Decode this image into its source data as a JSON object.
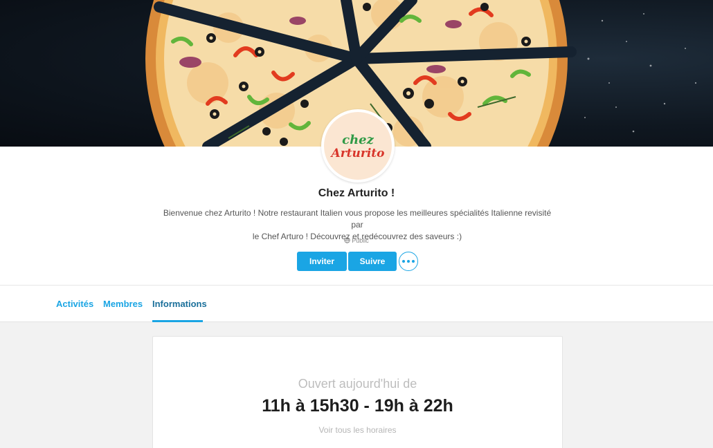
{
  "group": {
    "name": "Chez Arturito !",
    "description_line1": "Bienvenue chez Arturito ! Notre restaurant Italien vous propose les meilleures spécialités Italienne revisité par",
    "description_line2": "le Chef Arturo ! Découvrez et redécouvrez des saveurs :)",
    "visibility": "Public",
    "logo": {
      "line1": "chez",
      "line2": "Arturito"
    }
  },
  "actions": {
    "invite_label": "Inviter",
    "follow_label": "Suivre",
    "more_icon": "more-dots-icon"
  },
  "tabs": [
    {
      "label": "Activités",
      "active": false
    },
    {
      "label": "Membres",
      "active": false
    },
    {
      "label": "Informations",
      "active": true
    }
  ],
  "info_card": {
    "open_label": "Ouvert aujourd'hui de",
    "hours": "11h à 15h30 - 19h à 22h",
    "all_hours_link": "Voir tous les horaires"
  },
  "colors": {
    "accent": "#1aa5e4",
    "active_tab": "#1a6f9a",
    "logo_green": "#2f9a46",
    "logo_red": "#d8352a"
  }
}
